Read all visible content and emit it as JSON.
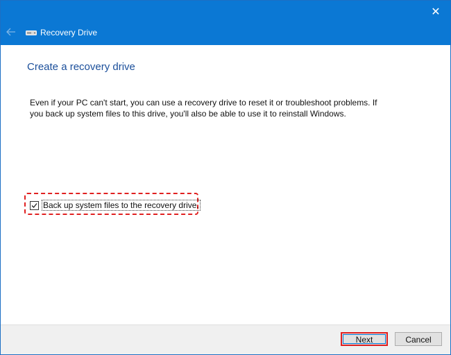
{
  "window": {
    "title": "Recovery Drive",
    "close_glyph": "✕",
    "back_glyph": "←",
    "accent": "#0b78d4"
  },
  "content": {
    "heading": "Create a recovery drive",
    "description": "Even if your PC can't start, you can use a recovery drive to reset it or troubleshoot problems. If you back up system files to this drive, you'll also be able to use it to reinstall Windows.",
    "backup_checkbox": {
      "label": "Back up system files to the recovery drive.",
      "checked": true
    },
    "highlight_color": "#e02020"
  },
  "footer": {
    "next_label": "Next",
    "cancel_label": "Cancel"
  },
  "icons": {
    "close": "close-icon",
    "back": "back-arrow-icon",
    "drive": "drive-icon",
    "check": "checkmark-icon"
  }
}
